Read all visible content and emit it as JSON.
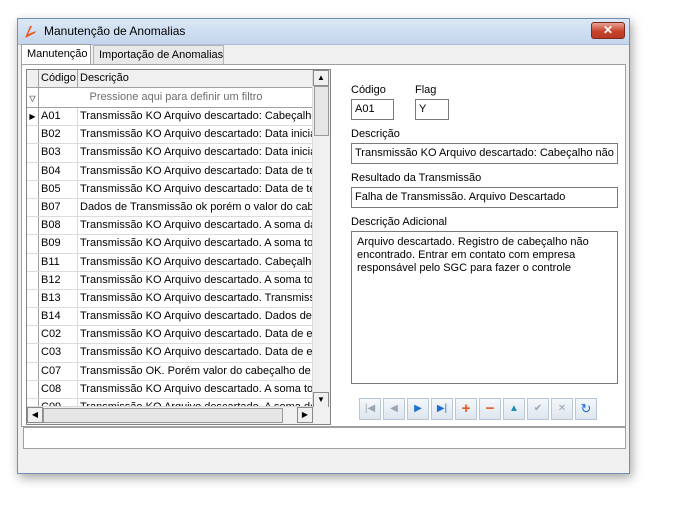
{
  "window": {
    "title": "Manutenção de Anomalias"
  },
  "tabs": [
    {
      "label": "Manutenção",
      "active": true
    },
    {
      "label": "Importação de Anomalias",
      "active": false
    }
  ],
  "grid": {
    "columns": [
      "Código",
      "Descrição"
    ],
    "filter_placeholder": "Pressione aqui para definir um filtro",
    "rows": [
      {
        "code": "A01",
        "desc": "Transmissão KO Arquivo descartado: Cabeçalho não encontrado",
        "selected": true
      },
      {
        "code": "B02",
        "desc": "Transmissão KO Arquivo descartado: Data inicial"
      },
      {
        "code": "B03",
        "desc": "Transmissão KO Arquivo descartado: Data inicial"
      },
      {
        "code": "B04",
        "desc": "Transmissão KO Arquivo descartado: Data de término"
      },
      {
        "code": "B05",
        "desc": "Transmissão KO Arquivo descartado: Data de término"
      },
      {
        "code": "B07",
        "desc": "Dados de Transmissão ok porém o valor do cabeçalho"
      },
      {
        "code": "B08",
        "desc": "Transmissão KO Arquivo descartado. A soma da"
      },
      {
        "code": "B09",
        "desc": "Transmissão KO Arquivo descartado.  A soma total"
      },
      {
        "code": "B11",
        "desc": "Transmissão KO Arquivo descartado. Cabeçalho"
      },
      {
        "code": "B12",
        "desc": "Transmissão KO Arquivo descartado.  A soma total"
      },
      {
        "code": "B13",
        "desc": "Transmissão KO Arquivo descartado. Transmissão"
      },
      {
        "code": "B14",
        "desc": "Transmissão KO Arquivo descartado. Dados de v"
      },
      {
        "code": "C02",
        "desc": "Transmissão KO Arquivo descartado. Data de ex"
      },
      {
        "code": "C03",
        "desc": "Transmissão KO Arquivo descartado. Data de ex"
      },
      {
        "code": "C07",
        "desc": "Transmissão OK. Porém valor do cabeçalho de qu"
      },
      {
        "code": "C08",
        "desc": "Transmissão KO Arquivo descartado. A soma total"
      },
      {
        "code": "C09",
        "desc": "Transmissão KO Arquivo descartado. A soma do"
      }
    ]
  },
  "form": {
    "codigo_label": "Código",
    "codigo_value": "A01",
    "flag_label": "Flag",
    "flag_value": "Y",
    "descricao_label": "Descrição",
    "descricao_value": "Transmissão KO Arquivo descartado: Cabeçalho não encontrado",
    "resultado_label": "Resultado da Transmissão",
    "resultado_value": "Falha de Transmissão. Arquivo Descartado",
    "adicional_label": "Descrição Adicional",
    "adicional_value": "Arquivo descartado. Registro de cabeçalho não encontrado. Entrar em contato com empresa responsável pelo SGC para fazer o controle"
  },
  "navigator": {
    "buttons": [
      "first-record-icon",
      "prior-record-icon",
      "next-record-icon",
      "last-record-icon",
      "insert-icon",
      "delete-icon",
      "edit-icon",
      "post-icon",
      "cancel-icon",
      "refresh-icon"
    ]
  },
  "colors": {
    "title_bar": "#c4d6ec",
    "close_button": "#c7432c",
    "nav_blue": "#1e6fd0",
    "nav_orange": "#e8581c"
  }
}
